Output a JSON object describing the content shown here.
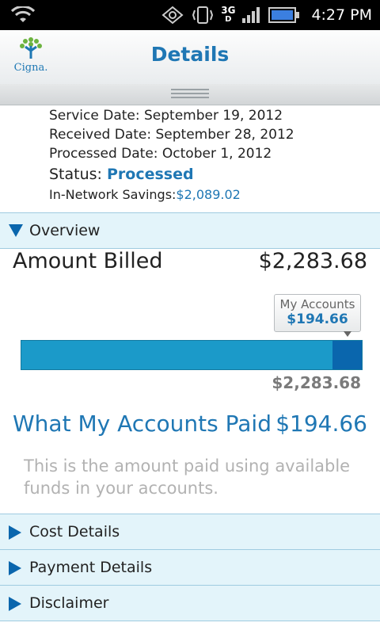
{
  "status_bar": {
    "network": "3G",
    "network_sub": "D",
    "time": "4:27 PM"
  },
  "header": {
    "title": "Details",
    "logo_text": "Cigna."
  },
  "claim": {
    "service_date": "Service Date: September 19, 2012",
    "received_date": "Received Date: September 28, 2012",
    "processed_date": "Processed Date: October 1, 2012",
    "status_label": "Status:",
    "status_value": "Processed",
    "savings_label": "In-Network Savings:",
    "savings_value": "$2,089.02"
  },
  "overview": {
    "label": "Overview",
    "amount_billed_label": "Amount Billed",
    "amount_billed_value": "$2,283.68",
    "tooltip_label": "My Accounts",
    "tooltip_value": "$194.66",
    "bar_total": "$2,283.68",
    "accounts_fraction": 0.0852,
    "paid_label": "What My Accounts Paid",
    "paid_value": "$194.66",
    "note": "This is the amount paid using available funds in your accounts."
  },
  "sections": {
    "cost_details": "Cost Details",
    "payment_details": "Payment Details",
    "disclaimer": "Disclaimer"
  },
  "colors": {
    "accent": "#1f77b4",
    "section_bg": "#e3f4fa",
    "bar_base": "#1b9ac9",
    "bar_fill": "#0a66ad"
  }
}
